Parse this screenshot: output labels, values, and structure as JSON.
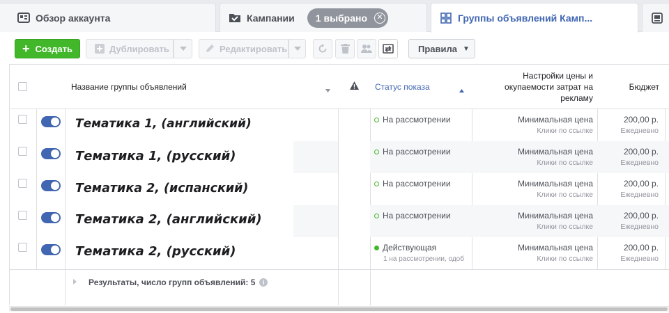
{
  "tabs": {
    "account_overview": "Обзор аккаунта",
    "campaigns": "Кампании",
    "selected_badge": "1 выбрано",
    "ad_sets": "Группы объявлений Камп..."
  },
  "toolbar": {
    "create": "Создать",
    "duplicate": "Дублировать",
    "edit": "Редактировать",
    "rules": "Правила"
  },
  "table": {
    "headers": {
      "name": "Название группы объявлений",
      "status": "Статус показа",
      "bid": "Настройки цены и окупаемости затрат на рекламу",
      "budget": "Бюджет"
    },
    "rows": [
      {
        "name": "Тематика 1, (английский)",
        "status": "На рассмотрении",
        "status_sub": "",
        "bid": "Минимальная цена",
        "bid_sub": "Клики по ссылке",
        "budget": "200,00 р.",
        "budget_sub": "Ежедневно"
      },
      {
        "name": "Тематика 1, (русский)",
        "status": "На рассмотрении",
        "status_sub": "",
        "bid": "Минимальная цена",
        "bid_sub": "Клики по ссылке",
        "budget": "200,00 р.",
        "budget_sub": "Ежедневно"
      },
      {
        "name": "Тематика 2, (испанский)",
        "status": "На рассмотрении",
        "status_sub": "",
        "bid": "Минимальная цена",
        "bid_sub": "Клики по ссылке",
        "budget": "200,00 р.",
        "budget_sub": "Ежедневно"
      },
      {
        "name": "Тематика 2, (английский)",
        "status": "На рассмотрении",
        "status_sub": "",
        "bid": "Минимальная цена",
        "bid_sub": "Клики по ссылке",
        "budget": "200,00 р.",
        "budget_sub": "Ежедневно"
      },
      {
        "name": "Тематика 2, (русский)",
        "status": "Действующая",
        "status_sub": "1 на рассмотрении, одоб",
        "bid": "Минимальная цена",
        "bid_sub": "Клики по ссылке",
        "budget": "200,00 р.",
        "budget_sub": "Ежедневно"
      }
    ],
    "footer": "Результаты, число групп объявлений: 5"
  },
  "colors": {
    "accent": "#4267b2",
    "create_green": "#42b72a",
    "status_green": "#42b72a",
    "badge_gray": "#90949c"
  }
}
